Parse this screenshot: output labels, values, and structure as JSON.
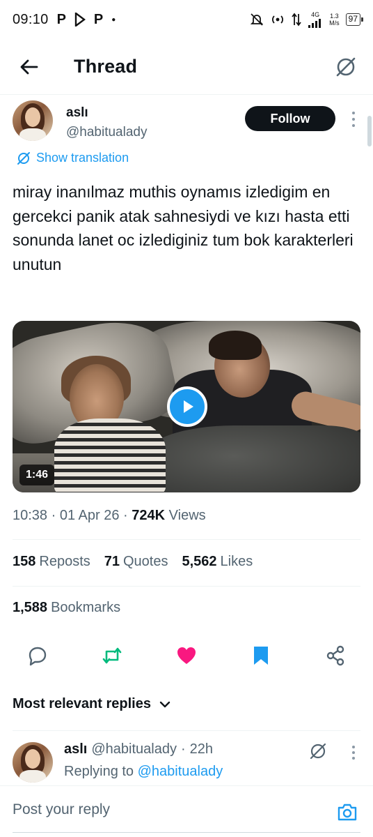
{
  "status_bar": {
    "time": "09:10",
    "notification_icons": [
      "P",
      "P"
    ],
    "network_type": "4G",
    "net_speed_value": "1.3",
    "net_speed_unit": "M/s",
    "battery": "97"
  },
  "header": {
    "title": "Thread"
  },
  "tweet": {
    "author_name": "aslı",
    "author_handle": "@habitualady",
    "follow_label": "Follow",
    "translate_label": "Show translation",
    "text": "miray inanılmaz muthis oynamıs izledigim en gercekci panik atak sahnesiydi ve kızı hasta etti sonunda lanet oc izlediginiz tum bok karakterleri unutun",
    "video_duration": "1:46",
    "time": "10:38",
    "date": "01 Apr 26",
    "views_count": "724K",
    "views_label": "Views",
    "reposts_count": "158",
    "reposts_label": "Reposts",
    "quotes_count": "71",
    "quotes_label": "Quotes",
    "likes_count": "5,562",
    "likes_label": "Likes",
    "bookmarks_count": "1,588",
    "bookmarks_label": "Bookmarks",
    "liked": true
  },
  "colors": {
    "accent": "#1d9bf0",
    "like": "#f91880",
    "repost": "#00ba7c",
    "text": "#0f1419",
    "secondary": "#536471"
  },
  "replies": {
    "sort_label": "Most relevant replies",
    "items": [
      {
        "name": "aslı",
        "handle": "@habitualady",
        "age": "22h",
        "replying_prefix": "Replying to",
        "replying_to": "@habitualady"
      }
    ]
  },
  "composer": {
    "placeholder": "Post your reply"
  }
}
